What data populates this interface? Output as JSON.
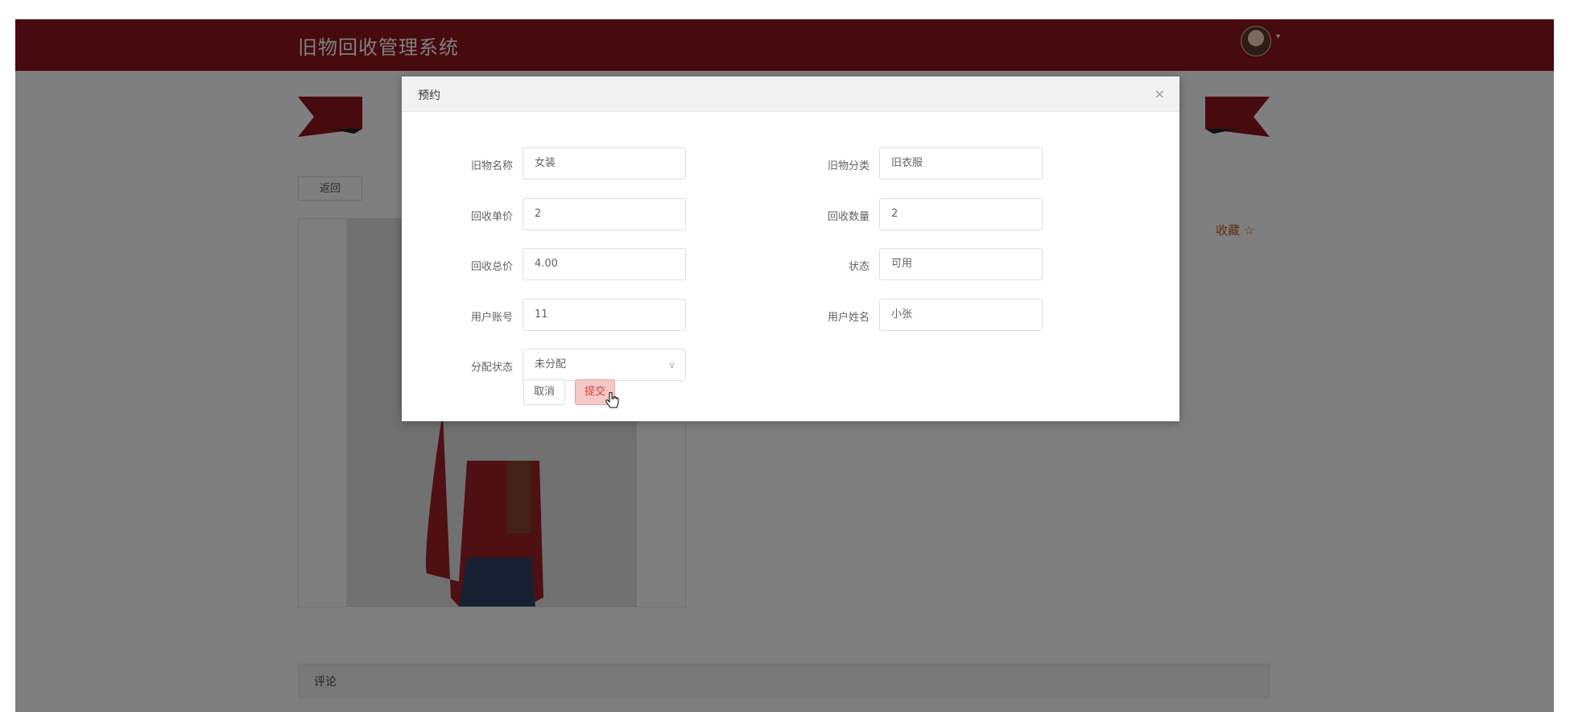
{
  "app": {
    "title": "旧物回收管理系统"
  },
  "page": {
    "back_label": "返回",
    "favorite_label": "收藏 ☆",
    "comment_label": "评论"
  },
  "modal": {
    "title": "预约",
    "close_glyph": "×",
    "fields": [
      {
        "label": "旧物名称",
        "value": "女装"
      },
      {
        "label": "旧物分类",
        "value": "旧衣服"
      },
      {
        "label": "回收单价",
        "value": "2"
      },
      {
        "label": "回收数量",
        "value": "2"
      },
      {
        "label": "回收总价",
        "value": "4.00"
      },
      {
        "label": "状态",
        "value": "可用"
      },
      {
        "label": "用户账号",
        "value": "11"
      },
      {
        "label": "用户姓名",
        "value": "小张"
      }
    ],
    "assign": {
      "label": "分配状态",
      "value": "未分配"
    },
    "cancel_label": "取消",
    "submit_label": "提交"
  },
  "icons": {
    "avatar": "user-avatar",
    "dropdown": "chevron-down-icon",
    "close": "close-icon",
    "cursor": "hand-pointer-icon"
  },
  "colors": {
    "header_bg": "#8f141c",
    "accent_red": "#d04040",
    "favorite": "#c45c1c"
  }
}
